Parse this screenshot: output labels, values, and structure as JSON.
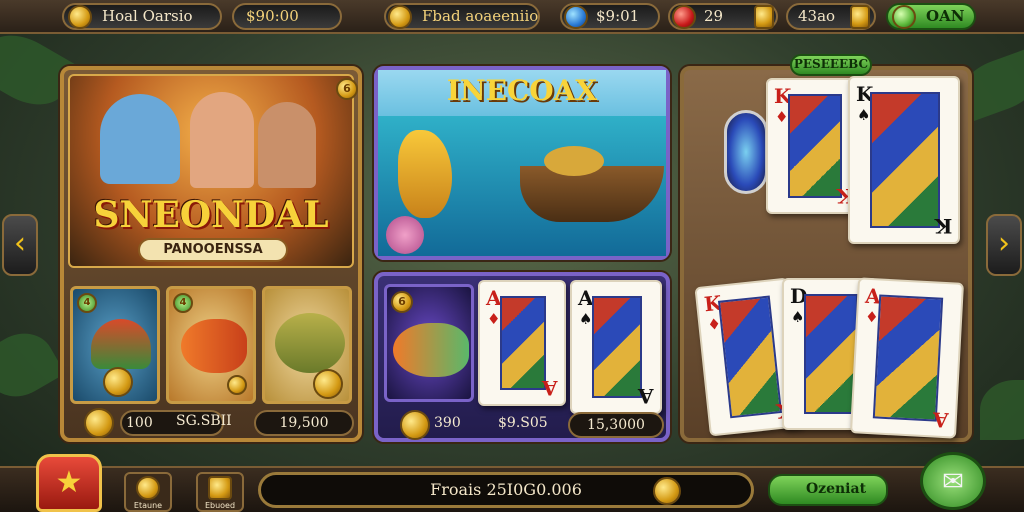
{
  "top_bar": {
    "title": "Hoal Oarsio",
    "balance": "$90:00",
    "bonus": "Fbad aoaeeniio",
    "gems": "$9:01",
    "lives": "29",
    "chips": "43ao",
    "action": "OAN"
  },
  "panel_left": {
    "title": "SNEONDAL",
    "subtitle": "PANOOENSSA",
    "badge": "6",
    "tile_badges": [
      "4",
      "4"
    ],
    "stats": {
      "coins": "100",
      "value": "SG.SBII",
      "score": "19,500"
    }
  },
  "panel_center_top": {
    "title": "INECOAX"
  },
  "panel_center_bottom": {
    "badge": "6",
    "cards": [
      {
        "rank": "A",
        "suit": "♦"
      },
      {
        "rank": "A",
        "suit": "♠"
      }
    ],
    "stats": {
      "coins": "390",
      "value": "$9.S05",
      "score": "15,3000"
    }
  },
  "panel_right": {
    "label": "PESEEEBC",
    "cards_top": [
      {
        "rank": "K",
        "suit": "♦"
      },
      {
        "rank": "K",
        "suit": "♠"
      }
    ],
    "cards_bottom": [
      {
        "rank": "K",
        "suit": "♦"
      },
      {
        "rank": "D",
        "suit": "♠"
      },
      {
        "rank": "A",
        "suit": "♦"
      }
    ]
  },
  "bottom_bar": {
    "nav_items": [
      "Etaune",
      "Ebuoed"
    ],
    "total": "Froais 25I0G0.006",
    "confirm": "Ozeniat"
  },
  "icons": {
    "home": "home-icon",
    "left": "chevron-left-icon",
    "right": "chevron-right-icon",
    "chat": "chat-icon"
  },
  "colors": {
    "accent": "#f2c21a",
    "green": "#4fae3a",
    "frame": "#b88838"
  }
}
